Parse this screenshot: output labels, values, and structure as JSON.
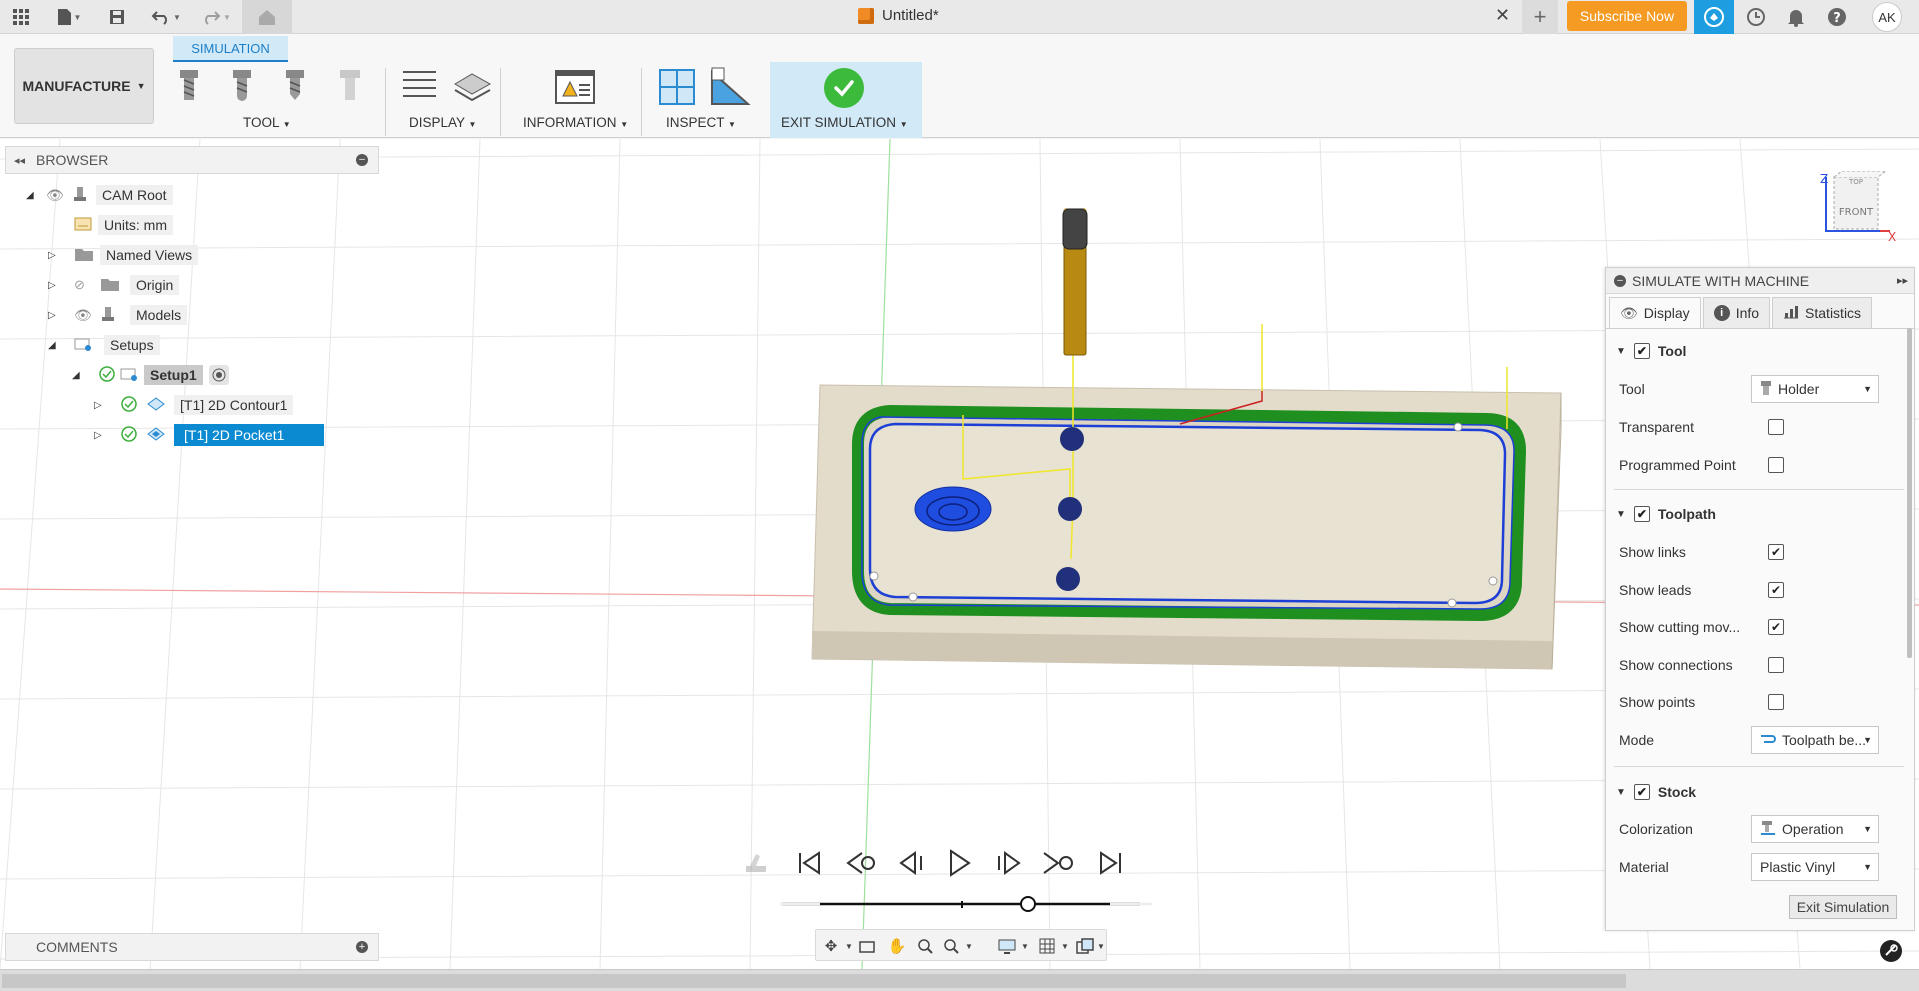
{
  "app": {
    "doc_title": "Untitled*",
    "subscribe_label": "Subscribe Now",
    "avatar_initials": "AK"
  },
  "toolbar": {
    "workspace_label": "MANUFACTURE",
    "active_tab": "SIMULATION",
    "groups": {
      "tool": "TOOL",
      "display": "DISPLAY",
      "information": "INFORMATION",
      "inspect": "INSPECT",
      "exit_simulation": "EXIT SIMULATION"
    }
  },
  "browser": {
    "title": "BROWSER",
    "items": [
      {
        "label": "CAM Root"
      },
      {
        "label": "Units: mm"
      },
      {
        "label": "Named Views"
      },
      {
        "label": "Origin"
      },
      {
        "label": "Models"
      },
      {
        "label": "Setups"
      },
      {
        "label": "Setup1"
      },
      {
        "label": "[T1] 2D Contour1"
      },
      {
        "label": "[T1] 2D Pocket1"
      }
    ]
  },
  "comments": {
    "title": "COMMENTS"
  },
  "view_cube": {
    "top": "TOP",
    "front": "FRONT",
    "axis_z": "Z",
    "axis_x": "X"
  },
  "sim_panel": {
    "title": "SIMULATE WITH MACHINE",
    "tabs": [
      "Display",
      "Info",
      "Statistics"
    ],
    "sections": {
      "tool": {
        "title": "Tool",
        "tool_label": "Tool",
        "tool_value": "Holder",
        "transparent_label": "Transparent",
        "programmed_point_label": "Programmed Point"
      },
      "toolpath": {
        "title": "Toolpath",
        "show_links": "Show links",
        "show_leads": "Show leads",
        "show_cutting": "Show cutting mov...",
        "show_connections": "Show connections",
        "show_points": "Show points",
        "mode_label": "Mode",
        "mode_value": "Toolpath be..."
      },
      "stock": {
        "title": "Stock",
        "colorization_label": "Colorization",
        "colorization_value": "Operation",
        "material_label": "Material",
        "material_value": "Plastic Vinyl"
      }
    },
    "exit_label": "Exit Simulation"
  }
}
